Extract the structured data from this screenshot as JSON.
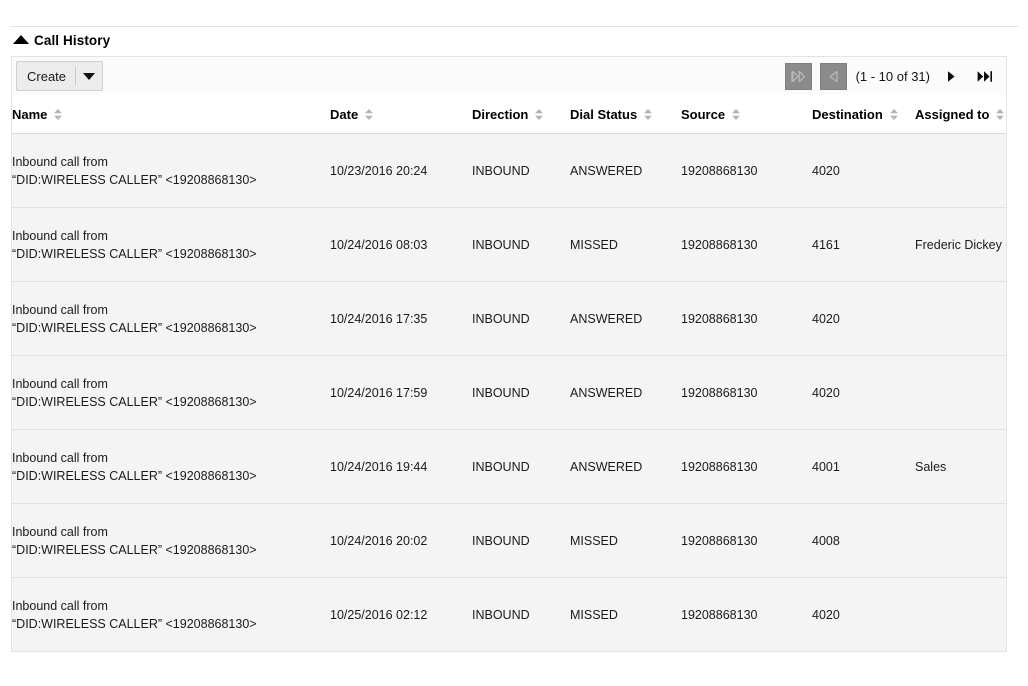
{
  "panel": {
    "title": "Call History",
    "collapse_icon": "caret-up-icon"
  },
  "toolbar": {
    "create_label": "Create",
    "create_caret_icon": "chevron-down-icon"
  },
  "pagination": {
    "first_icon": "first-page-icon",
    "prev_icon": "previous-page-icon",
    "range_text": "(1 - 10 of 31)",
    "next_icon": "next-page-icon",
    "last_icon": "last-page-icon",
    "first_disabled": true,
    "prev_disabled": true,
    "start": 1,
    "end": 10,
    "total": 31
  },
  "table": {
    "sort_icon": "sort-updown-icon",
    "columns": [
      {
        "key": "name",
        "label": "Name"
      },
      {
        "key": "date",
        "label": "Date"
      },
      {
        "key": "direction",
        "label": "Direction"
      },
      {
        "key": "dial_status",
        "label": "Dial Status"
      },
      {
        "key": "source",
        "label": "Source"
      },
      {
        "key": "destination",
        "label": "Destination"
      },
      {
        "key": "assigned_to",
        "label": "Assigned to"
      }
    ],
    "rows": [
      {
        "name_line1": "Inbound call from",
        "name_line2": "“DID:WIRELESS CALLER” <19208868130>",
        "date": "10/23/2016 20:24",
        "direction": "INBOUND",
        "dial_status": "ANSWERED",
        "source": "19208868130",
        "destination": "4020",
        "assigned_to": ""
      },
      {
        "name_line1": "Inbound call from",
        "name_line2": "“DID:WIRELESS CALLER” <19208868130>",
        "date": "10/24/2016 08:03",
        "direction": "INBOUND",
        "dial_status": "MISSED",
        "source": "19208868130",
        "destination": "4161",
        "assigned_to": "Frederic Dickey"
      },
      {
        "name_line1": "Inbound call from",
        "name_line2": "“DID:WIRELESS CALLER” <19208868130>",
        "date": "10/24/2016 17:35",
        "direction": "INBOUND",
        "dial_status": "ANSWERED",
        "source": "19208868130",
        "destination": "4020",
        "assigned_to": ""
      },
      {
        "name_line1": "Inbound call from",
        "name_line2": "“DID:WIRELESS CALLER” <19208868130>",
        "date": "10/24/2016 17:59",
        "direction": "INBOUND",
        "dial_status": "ANSWERED",
        "source": "19208868130",
        "destination": "4020",
        "assigned_to": ""
      },
      {
        "name_line1": "Inbound call from",
        "name_line2": "“DID:WIRELESS CALLER” <19208868130>",
        "date": "10/24/2016 19:44",
        "direction": "INBOUND",
        "dial_status": "ANSWERED",
        "source": "19208868130",
        "destination": "4001",
        "assigned_to": "Sales"
      },
      {
        "name_line1": "Inbound call from",
        "name_line2": "“DID:WIRELESS CALLER” <19208868130>",
        "date": "10/24/2016 20:02",
        "direction": "INBOUND",
        "dial_status": "MISSED",
        "source": "19208868130",
        "destination": "4008",
        "assigned_to": ""
      },
      {
        "name_line1": "Inbound call from",
        "name_line2": "“DID:WIRELESS CALLER” <19208868130>",
        "date": "10/25/2016 02:12",
        "direction": "INBOUND",
        "dial_status": "MISSED",
        "source": "19208868130",
        "destination": "4020",
        "assigned_to": ""
      }
    ]
  },
  "colors": {
    "row_background": "#f4f4f4",
    "border": "#e3e3e3",
    "disabled_button": "#8b8b8b",
    "text": "#1a1a1a"
  }
}
